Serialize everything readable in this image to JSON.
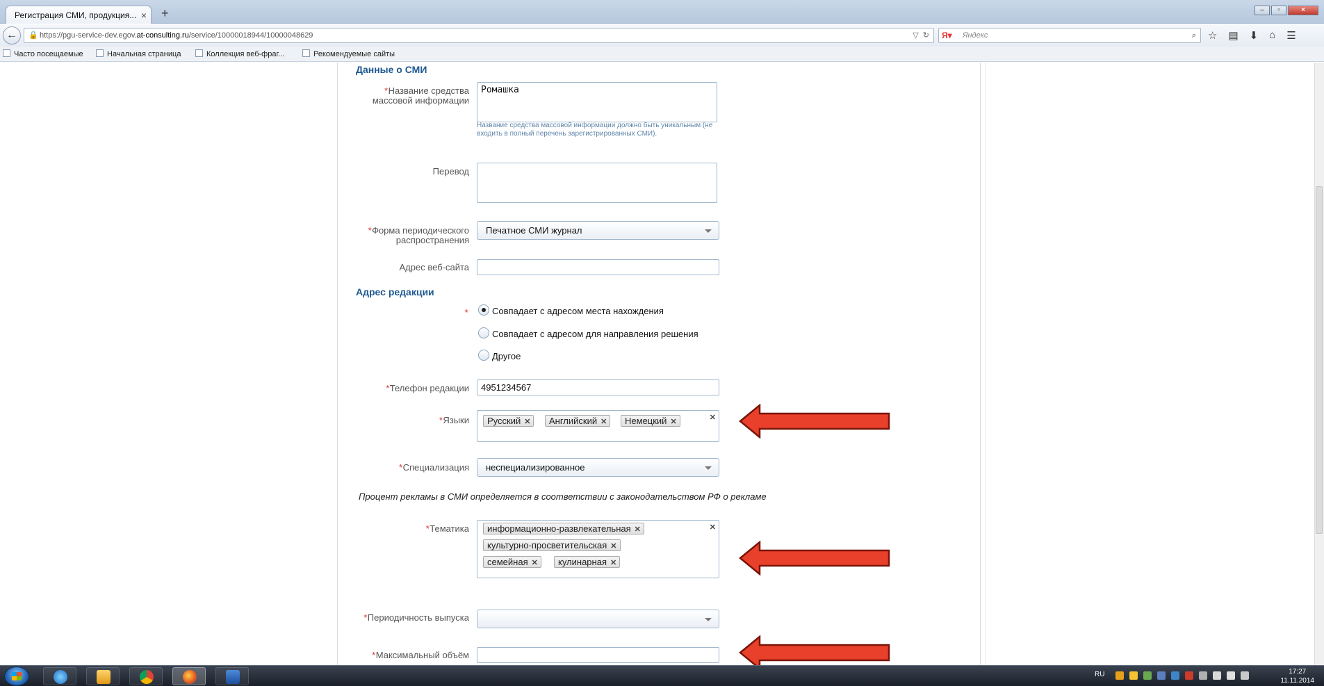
{
  "browser": {
    "tab_title": "Регистрация СМИ, продукция...",
    "tab_close": "×",
    "new_tab": "+",
    "url_prefix": "https://pgu-service-dev.egov.",
    "url_host": "at-consulting.ru",
    "url_path": "/service/10000018944/10000048629",
    "search_placeholder": "Яндекс",
    "search_engine_icon": "yandex-icon",
    "bookmarks": [
      "Часто посещаемые",
      "Начальная страница",
      "Коллекция веб-фраг...",
      "Рекомендуемые сайты"
    ]
  },
  "form": {
    "section_media": "Данные о СМИ",
    "name_label": "Название средства массовой информации",
    "name_value": "Ромашка",
    "name_hint": "Название средства массовой информации должно быть уникальным (не входить в полный перечень зарегистрированных СМИ).",
    "translation_label": "Перевод",
    "translation_value": "",
    "form_label": "Форма периодического распространения",
    "form_value": "Печатное СМИ журнал",
    "website_label": "Адрес веб-сайта",
    "website_value": "",
    "section_address": "Адрес редакции",
    "address_options": [
      {
        "label": "Совпадает с адресом места нахождения",
        "checked": true
      },
      {
        "label": "Совпадает с адресом для направления решения",
        "checked": false
      },
      {
        "label": "Другое",
        "checked": false
      }
    ],
    "phone_label": "Телефон редакции",
    "phone_value": "4951234567",
    "languages_label": "Языки",
    "languages": [
      "Русский",
      "Английский",
      "Немецкий"
    ],
    "specialization_label": "Специализация",
    "specialization_value": "неспециализированное",
    "ad_note": "Процент рекламы в СМИ определяется в соответствии с законодательством РФ о рекламе",
    "topics_label": "Тематика",
    "topics": [
      "информационно-развлекательная",
      "культурно-просветительская",
      "семейная",
      "кулинарная"
    ],
    "periodicity_label": "Периодичность выпуска",
    "periodicity_value": "",
    "max_volume_label": "Максимальный объём",
    "max_volume_value": ""
  },
  "annotations": {
    "arrow_color": "#e8402a",
    "arrow_stroke": "#7a1408"
  },
  "taskbar": {
    "language": "RU",
    "time": "17:27",
    "date": "11.11.2014"
  }
}
